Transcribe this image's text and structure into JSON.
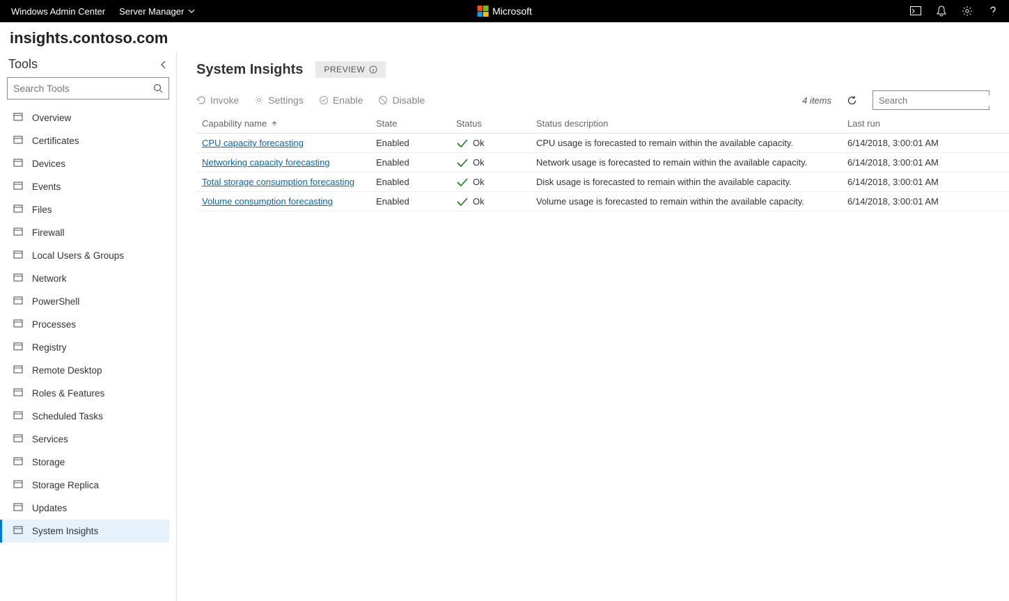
{
  "topbar": {
    "brand": "Windows Admin Center",
    "context": "Server Manager",
    "ms_label": "Microsoft"
  },
  "host": "insights.contoso.com",
  "sidebar": {
    "title": "Tools",
    "search_placeholder": "Search Tools",
    "items": [
      {
        "label": "Overview",
        "icon": "device"
      },
      {
        "label": "Certificates",
        "icon": "cert"
      },
      {
        "label": "Devices",
        "icon": "hw"
      },
      {
        "label": "Events",
        "icon": "list"
      },
      {
        "label": "Files",
        "icon": "folder"
      },
      {
        "label": "Firewall",
        "icon": "shield"
      },
      {
        "label": "Local Users & Groups",
        "icon": "users"
      },
      {
        "label": "Network",
        "icon": "net"
      },
      {
        "label": "PowerShell",
        "icon": "ps"
      },
      {
        "label": "Processes",
        "icon": "proc"
      },
      {
        "label": "Registry",
        "icon": "grid"
      },
      {
        "label": "Remote Desktop",
        "icon": "remote"
      },
      {
        "label": "Roles & Features",
        "icon": "roles"
      },
      {
        "label": "Scheduled Tasks",
        "icon": "task"
      },
      {
        "label": "Services",
        "icon": "svc"
      },
      {
        "label": "Storage",
        "icon": "storage"
      },
      {
        "label": "Storage Replica",
        "icon": "replica"
      },
      {
        "label": "Updates",
        "icon": "update"
      },
      {
        "label": "System Insights",
        "icon": "insights",
        "active": true
      }
    ]
  },
  "page": {
    "title": "System Insights",
    "badge": "PREVIEW"
  },
  "cmdbar": {
    "invoke": "Invoke",
    "settings": "Settings",
    "enable": "Enable",
    "disable": "Disable",
    "count": "4 items",
    "filter_placeholder": "Search"
  },
  "table": {
    "headers": {
      "name": "Capability name",
      "state": "State",
      "status": "Status",
      "desc": "Status description",
      "last": "Last run"
    },
    "rows": [
      {
        "name": "CPU capacity forecasting",
        "state": "Enabled",
        "status": "Ok",
        "desc": "CPU usage is forecasted to remain within the available capacity.",
        "last": "6/14/2018, 3:00:01 AM"
      },
      {
        "name": "Networking capacity forecasting",
        "state": "Enabled",
        "status": "Ok",
        "desc": "Network usage is forecasted to remain within the available capacity.",
        "last": "6/14/2018, 3:00:01 AM"
      },
      {
        "name": "Total storage consumption forecasting",
        "state": "Enabled",
        "status": "Ok",
        "desc": "Disk usage is forecasted to remain within the available capacity.",
        "last": "6/14/2018, 3:00:01 AM"
      },
      {
        "name": "Volume consumption forecasting",
        "state": "Enabled",
        "status": "Ok",
        "desc": "Volume usage is forecasted to remain within the available capacity.",
        "last": "6/14/2018, 3:00:01 AM"
      }
    ]
  }
}
